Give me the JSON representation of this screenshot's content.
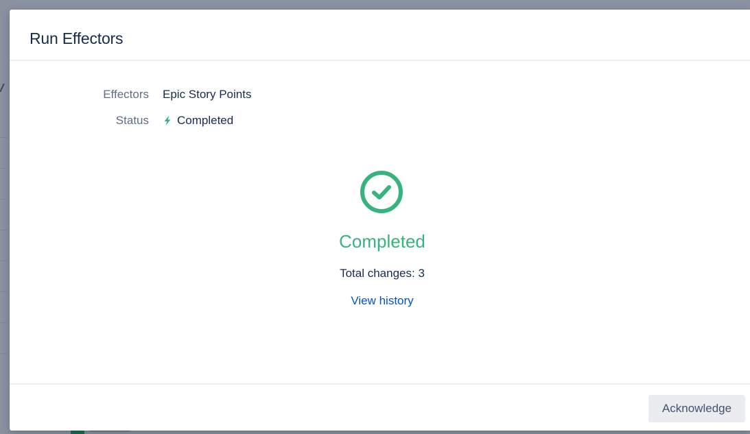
{
  "modal": {
    "title": "Run Effectors",
    "fields": {
      "effectors_label": "Effectors",
      "effectors_value": "Epic Story Points",
      "status_label": "Status",
      "status_value": "Completed",
      "status_icon": "lightning-bolt-icon"
    },
    "result": {
      "icon": "check-circle-icon",
      "title": "Completed",
      "total_changes": "Total changes: 3",
      "view_history_link": "View history"
    },
    "footer": {
      "acknowledge_label": "Acknowledge"
    }
  },
  "colors": {
    "success": "#36B37E",
    "link": "#0052CC",
    "text": "#172B4D",
    "label": "#5E6C84",
    "button_bg": "#EBECF0",
    "overlay": "#8A929F"
  }
}
